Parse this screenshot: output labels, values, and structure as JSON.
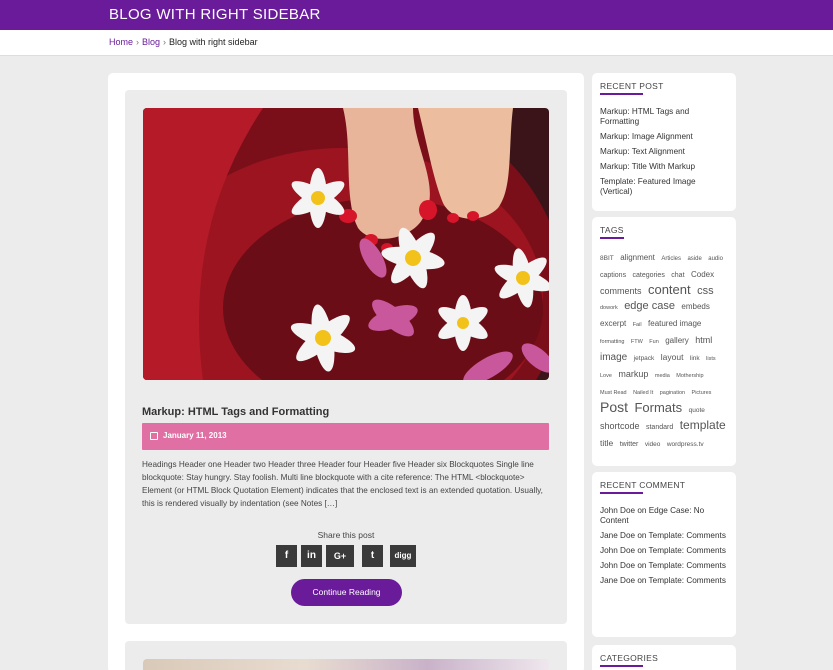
{
  "header": {
    "title": "BLOG WITH RIGHT SIDEBAR"
  },
  "breadcrumb": {
    "home": "Home",
    "blog": "Blog",
    "current": "Blog with right sidebar",
    "separator": "›"
  },
  "post": {
    "title": "Markup: HTML Tags and Formatting",
    "date": "January 11, 2013",
    "excerpt": "Headings Header one Header two Header three Header four Header five Header six Blockquotes Single line blockquote: Stay hungry. Stay foolish. Multi line blockquote with a cite reference: The HTML <blockquote> Element (or HTML Block Quotation Element) indicates that the enclosed text is an extended quotation. Usually, this is rendered visually by indentation (see Notes […]",
    "share_label": "Share this post",
    "share_buttons": [
      {
        "icon": "facebook-icon",
        "glyph": "f"
      },
      {
        "icon": "linkedin-icon",
        "glyph": "in"
      },
      {
        "icon": "google-plus-icon",
        "glyph": "G+"
      },
      {
        "icon": "twitter-icon",
        "glyph": "t"
      },
      {
        "icon": "digg-icon",
        "glyph": "digg"
      }
    ],
    "continue_label": "Continue Reading"
  },
  "sidebar": {
    "recent_posts": {
      "title": "RECENT POST",
      "items": [
        "Markup: HTML Tags and Formatting",
        "Markup: Image Alignment",
        "Markup: Text Alignment",
        "Markup: Title With Markup",
        "Template: Featured Image (Vertical)"
      ]
    },
    "tags": {
      "title": "TAGS",
      "items": [
        {
          "label": "8BIT",
          "size": 6.5
        },
        {
          "label": "alignment",
          "size": 8
        },
        {
          "label": "Articles",
          "size": 6
        },
        {
          "label": "aside",
          "size": 6
        },
        {
          "label": "audio",
          "size": 6
        },
        {
          "label": "captions",
          "size": 7
        },
        {
          "label": "categories",
          "size": 7
        },
        {
          "label": "chat",
          "size": 7
        },
        {
          "label": "Codex",
          "size": 8
        },
        {
          "label": "comments",
          "size": 9
        },
        {
          "label": "content",
          "size": 13
        },
        {
          "label": "css",
          "size": 11
        },
        {
          "label": "dowork",
          "size": 5.5
        },
        {
          "label": "edge case",
          "size": 11
        },
        {
          "label": "embeds",
          "size": 8
        },
        {
          "label": "excerpt",
          "size": 8
        },
        {
          "label": "Fail",
          "size": 5.5
        },
        {
          "label": "featured image",
          "size": 8
        },
        {
          "label": "formatting",
          "size": 5.5
        },
        {
          "label": "FTW",
          "size": 5.5
        },
        {
          "label": "Fun",
          "size": 5.5
        },
        {
          "label": "gallery",
          "size": 8
        },
        {
          "label": "html",
          "size": 9
        },
        {
          "label": "image",
          "size": 10
        },
        {
          "label": "jetpack",
          "size": 6.5
        },
        {
          "label": "layout",
          "size": 8.5
        },
        {
          "label": "link",
          "size": 6.5
        },
        {
          "label": "lists",
          "size": 5.5
        },
        {
          "label": "Love",
          "size": 5.5
        },
        {
          "label": "markup",
          "size": 9
        },
        {
          "label": "media",
          "size": 5.5
        },
        {
          "label": "Mothership",
          "size": 5.5
        },
        {
          "label": "Must Read",
          "size": 5.5
        },
        {
          "label": "Nailed It",
          "size": 5.5
        },
        {
          "label": "pagination",
          "size": 5.5
        },
        {
          "label": "Pictures",
          "size": 5.5
        },
        {
          "label": "Post",
          "size": 14
        },
        {
          "label": "Formats",
          "size": 13
        },
        {
          "label": "quote",
          "size": 6.5
        },
        {
          "label": "shortcode",
          "size": 9
        },
        {
          "label": "standard",
          "size": 7
        },
        {
          "label": "template",
          "size": 12
        },
        {
          "label": "title",
          "size": 8.5
        },
        {
          "label": "twitter",
          "size": 7
        },
        {
          "label": "video",
          "size": 6.5
        },
        {
          "label": "wordpress.tv",
          "size": 6.5
        }
      ]
    },
    "recent_comments": {
      "title": "RECENT COMMENT",
      "items": [
        "John Doe on Edge Case: No Content",
        "Jane Doe on Template: Comments",
        "John Doe on Template: Comments",
        "John Doe on Template: Comments",
        "Jane Doe on Template: Comments"
      ]
    },
    "categories": {
      "title": "CATEGORIES"
    }
  },
  "colors": {
    "brand": "#6a1b9a",
    "date_bar": "#e06fa3",
    "page_bg": "#ececec"
  }
}
